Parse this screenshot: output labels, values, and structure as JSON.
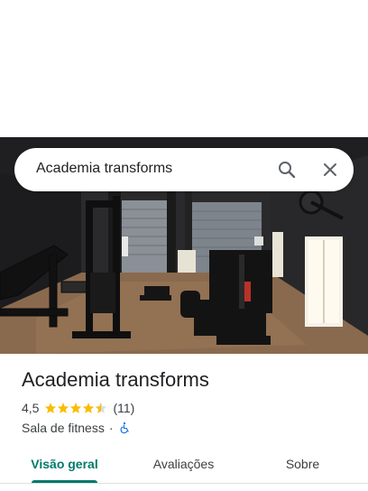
{
  "search": {
    "query": "Academia transforms",
    "search_icon": "search-icon",
    "close_icon": "close-icon"
  },
  "photo": {
    "subject": "gym interior photo"
  },
  "place": {
    "name": "Academia transforms",
    "rating": "4,5",
    "rating_stars": 4.5,
    "reviews": "(11)",
    "category": "Sala de fitness",
    "separator": "·",
    "accessibility_icon": "wheelchair-icon"
  },
  "tabs": [
    {
      "label": "Visão geral",
      "active": true
    },
    {
      "label": "Avaliações",
      "active": false
    },
    {
      "label": "Sobre",
      "active": false
    }
  ],
  "colors": {
    "accent": "#00796b",
    "star": "#fbbc04",
    "wheelchair": "#1a73e8"
  }
}
